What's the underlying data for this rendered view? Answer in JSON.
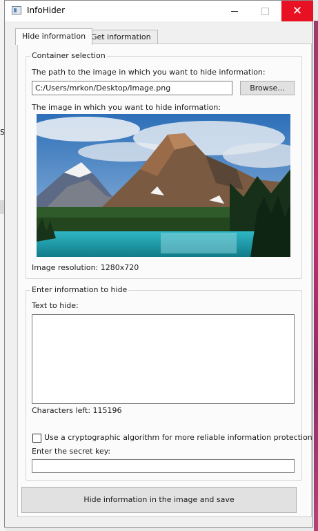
{
  "window": {
    "title": "InfoHider",
    "minimize_glyph": "",
    "close_glyph": "✕"
  },
  "background": {
    "left_glyph": "S"
  },
  "tabs": [
    {
      "label": "Hide information",
      "active": true
    },
    {
      "label": "Get information",
      "active": false
    }
  ],
  "container_selection": {
    "title": "Container selection",
    "path_label": "The path to the image in which you want to hide information:",
    "path_value": "C:/Users/mrkon/Desktop/Image.png",
    "browse_label": "Browse...",
    "image_label": "The image in which you want to hide information:",
    "image_icon": "mountain-lake-landscape-image",
    "resolution_text": "Image resolution: 1280x720"
  },
  "info_to_hide": {
    "title": "Enter information to hide",
    "text_label": "Text to hide:",
    "text_value": "",
    "chars_left_text": "Characters left: 115196",
    "crypto_checkbox_label": "Use a cryptographic algorithm for more reliable information protection",
    "crypto_checked": false,
    "secret_key_label": "Enter the secret key:",
    "secret_key_value": ""
  },
  "action": {
    "hide_button_label": "Hide information in the image and save"
  },
  "colors": {
    "close_button": "#e81123",
    "window_bg": "#f0f0f0",
    "panel_bg": "#fbfbfb"
  }
}
